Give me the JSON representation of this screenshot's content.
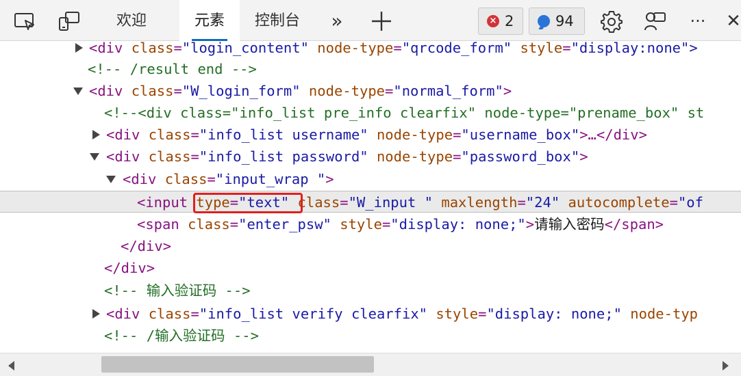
{
  "toolbar": {
    "tabs": [
      {
        "label": "欢迎"
      },
      {
        "label": "元素"
      },
      {
        "label": "控制台"
      }
    ],
    "more_tabs_glyph": "»",
    "add_tab_glyph": "+",
    "errors_count": "2",
    "error_glyph": "×",
    "messages_count": "94",
    "more_menu_glyph": "···",
    "close_glyph": "✕",
    "icons": [
      "device-emulation-icon",
      "dock-icon",
      "chevron-double-right-icon",
      "plus-icon",
      "error-icon",
      "message-icon",
      "gear-icon",
      "feedback-icon",
      "more-icon",
      "close-icon"
    ],
    "accent_color": "#0f6cbd"
  },
  "dom_tree": {
    "lines": [
      {
        "t1": "<div ",
        "a1": "class",
        "e1": "=",
        "v1": "\"login_content\"",
        "a2": "node-type",
        "e2": "=",
        "v2": "\"qrcode_form\"",
        "a3": "style",
        "e3": "=",
        "v3": "\"display:none\">"
      },
      {
        "comment": "<!-- /result end -->"
      },
      {
        "t1": "<div ",
        "a1": "class",
        "e1": "=",
        "v1": "\"W_login_form\"",
        "a2": "node-type",
        "e2": "=",
        "v2": "\"normal_form\"",
        "t2": ">"
      },
      {
        "comment": "<!--<div class=\"info_list pre_info clearfix\" node-type=\"prename_box\" st"
      },
      {
        "t1": "<div ",
        "a1": "class",
        "e1": "=",
        "v1": "\"info_list username\"",
        "a2": "node-type",
        "e2": "=",
        "v2": "\"username_box\"",
        "t2": ">…</div>"
      },
      {
        "t1": "<div ",
        "a1": "class",
        "e1": "=",
        "v1": "\"info_list password\"",
        "a2": "node-type",
        "e2": "=",
        "v2": "\"password_box\"",
        "t2": ">"
      },
      {
        "t1": "<div ",
        "a1": "class",
        "e1": "=",
        "v1": "\"input_wrap \"",
        "t2": ">"
      },
      {
        "t1": "<input ",
        "a1": "type",
        "e1": "=",
        "v1": "\"text\"",
        "a2": "class",
        "e2": "=",
        "v2": "\"W_input \"",
        "a3": "maxlength",
        "e3": "=",
        "v3": "\"24\"",
        "a4": "autocomplete",
        "e4": "=",
        "v4": "\"of"
      },
      {
        "t1": "<span ",
        "a1": "class",
        "e1": "=",
        "v1": "\"enter_psw\"",
        "a2": "style",
        "e2": "=",
        "v2": "\"display: none;\"",
        "t2": ">",
        "text": "请输入密码",
        "t3": "</span>"
      },
      {
        "t1": "</div>"
      },
      {
        "t1": "</div>"
      },
      {
        "comment_open": "<!-- ",
        "comment_text": "输入验证码",
        "comment_close": " -->"
      },
      {
        "t1": "<div ",
        "a1": "class",
        "e1": "=",
        "v1": "\"info_list verify clearfix\"",
        "a2": "style",
        "e2": "=",
        "v2": "\"display: none;\"",
        "a3": "node-typ"
      },
      {
        "comment_open": "<!-- /",
        "comment_text": "输入验证码",
        "comment_close": " -->"
      }
    ]
  },
  "colors": {
    "tag": "#881280",
    "attr_name": "#994500",
    "attr_value": "#1a1aa6",
    "comment": "#236e25",
    "highlight_box": "#e02020"
  }
}
